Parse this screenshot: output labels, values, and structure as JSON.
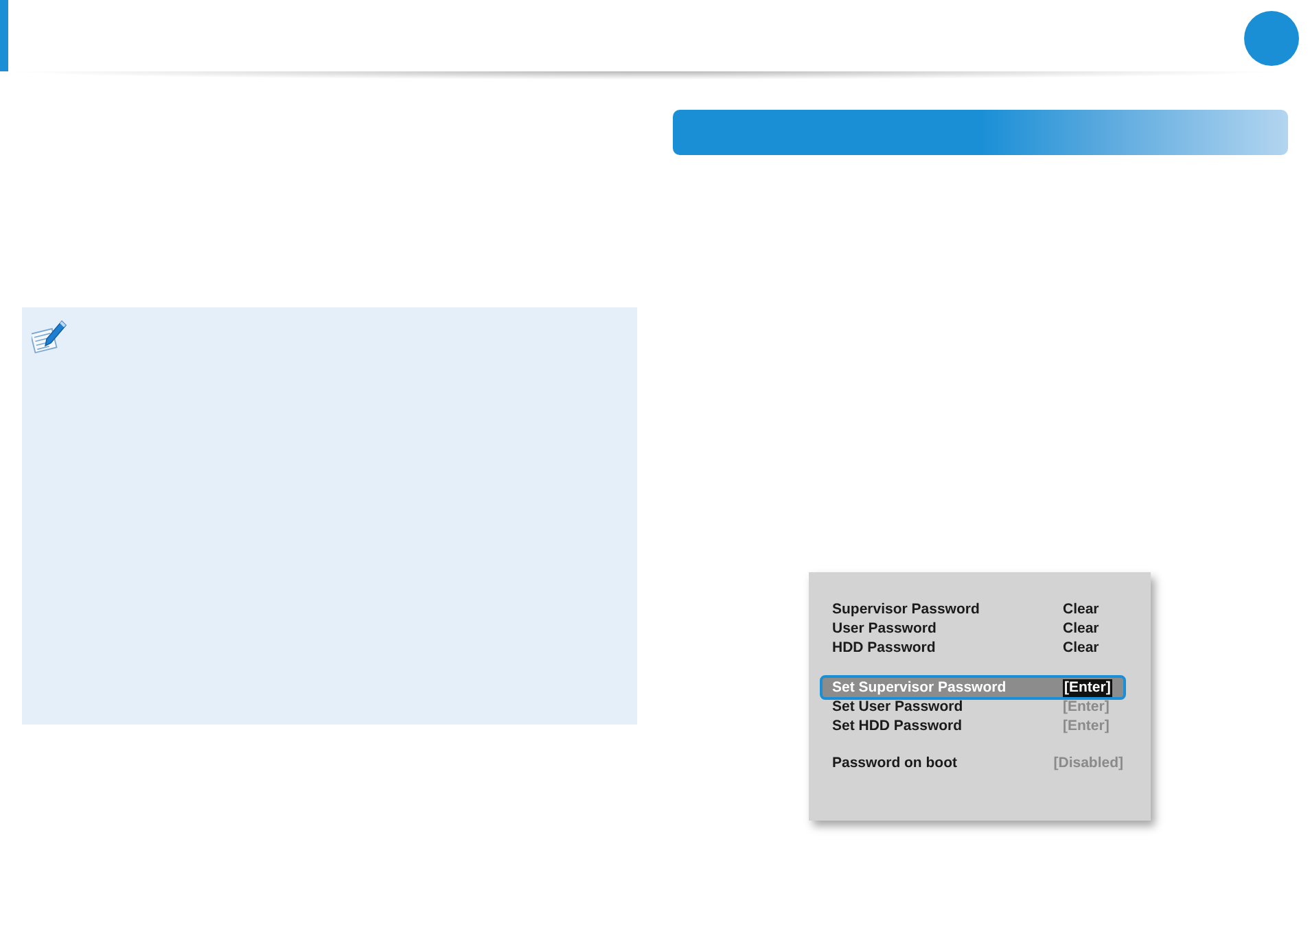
{
  "bios_screen": {
    "groups": [
      {
        "rows": [
          {
            "label": "Supervisor Password",
            "value": "Clear",
            "kind": "status",
            "selected": false
          },
          {
            "label": "User Password",
            "value": "Clear",
            "kind": "status",
            "selected": false
          },
          {
            "label": "HDD Password",
            "value": "Clear",
            "kind": "status",
            "selected": false
          }
        ]
      },
      {
        "rows": [
          {
            "label": "Set Supervisor Password",
            "value": "[Enter]",
            "kind": "option",
            "selected": true
          },
          {
            "label": "Set User Password",
            "value": "[Enter]",
            "kind": "option",
            "selected": false
          },
          {
            "label": "Set HDD Password",
            "value": "[Enter]",
            "kind": "option",
            "selected": false
          }
        ]
      },
      {
        "rows": [
          {
            "label": "Password on boot",
            "value": "[Disabled]",
            "kind": "option",
            "selected": false
          }
        ]
      }
    ]
  }
}
